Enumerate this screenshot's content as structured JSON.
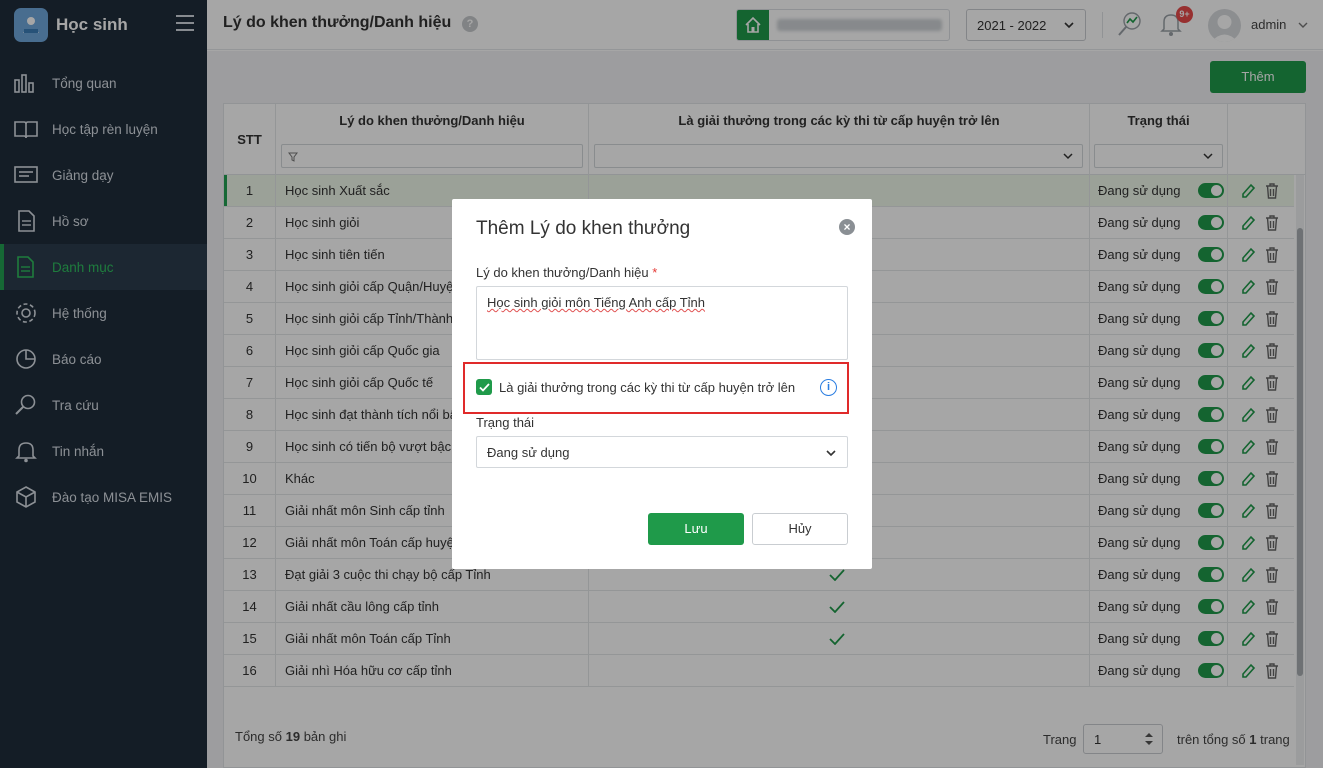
{
  "app": {
    "name": "Học sinh"
  },
  "sidebar": {
    "items": [
      {
        "label": "Tổng quan",
        "icon": "bar-chart-icon"
      },
      {
        "label": "Học tập rèn luyện",
        "icon": "book-icon"
      },
      {
        "label": "Giảng dạy",
        "icon": "board-icon"
      },
      {
        "label": "Hồ sơ",
        "icon": "document-icon"
      },
      {
        "label": "Danh mục",
        "icon": "list-icon",
        "active": true
      },
      {
        "label": "Hệ thống",
        "icon": "gear-icon"
      },
      {
        "label": "Báo cáo",
        "icon": "pie-chart-icon"
      },
      {
        "label": "Tra cứu",
        "icon": "search-icon"
      },
      {
        "label": "Tin nhắn",
        "icon": "bell-icon"
      },
      {
        "label": "Đào tạo MISA EMIS",
        "icon": "cube-icon"
      }
    ]
  },
  "header": {
    "title": "Lý do khen thưởng/Danh hiệu",
    "help": "?",
    "year": "2021 - 2022",
    "notification_badge": "9+",
    "username": "admin"
  },
  "toolbar": {
    "add_label": "Thêm"
  },
  "grid": {
    "columns": {
      "stt": "STT",
      "reason": "Lý do khen thưởng/Danh hiệu",
      "district": "Là giải thưởng trong các kỳ thi từ cấp huyện trở lên",
      "status": "Trạng thái"
    },
    "rows": [
      {
        "stt": "1",
        "reason": "Học sinh Xuất sắc",
        "district": false,
        "status": "Đang sử dụng"
      },
      {
        "stt": "2",
        "reason": "Học sinh giỏi",
        "district": false,
        "status": "Đang sử dụng"
      },
      {
        "stt": "3",
        "reason": "Học sinh tiên tiến",
        "district": false,
        "status": "Đang sử dụng"
      },
      {
        "stt": "4",
        "reason": "Học sinh giỏi cấp Quận/Huyện",
        "district": false,
        "status": "Đang sử dụng"
      },
      {
        "stt": "5",
        "reason": "Học sinh giỏi cấp Tỉnh/Thành phố",
        "district": false,
        "status": "Đang sử dụng"
      },
      {
        "stt": "6",
        "reason": "Học sinh giỏi cấp Quốc gia",
        "district": false,
        "status": "Đang sử dụng"
      },
      {
        "stt": "7",
        "reason": "Học sinh giỏi cấp Quốc tế",
        "district": false,
        "status": "Đang sử dụng"
      },
      {
        "stt": "8",
        "reason": "Học sinh đạt thành tích nổi bật",
        "district": false,
        "status": "Đang sử dụng"
      },
      {
        "stt": "9",
        "reason": "Học sinh có tiến bộ vượt bậc",
        "district": false,
        "status": "Đang sử dụng"
      },
      {
        "stt": "10",
        "reason": "Khác",
        "district": false,
        "status": "Đang sử dụng"
      },
      {
        "stt": "11",
        "reason": "Giải nhất môn Sinh cấp tỉnh",
        "district": false,
        "status": "Đang sử dụng"
      },
      {
        "stt": "12",
        "reason": "Giải nhất môn Toán cấp huyện",
        "district": false,
        "status": "Đang sử dụng"
      },
      {
        "stt": "13",
        "reason": "Đạt giải 3 cuộc thi chạy bộ cấp Tỉnh",
        "district": true,
        "status": "Đang sử dụng"
      },
      {
        "stt": "14",
        "reason": "Giải nhất cầu lông cấp tỉnh",
        "district": true,
        "status": "Đang sử dụng"
      },
      {
        "stt": "15",
        "reason": "Giải nhất môn Toán cấp Tỉnh",
        "district": true,
        "status": "Đang sử dụng"
      },
      {
        "stt": "16",
        "reason": "Giải nhì Hóa hữu cơ cấp tỉnh",
        "district": false,
        "status": "Đang sử dụng"
      }
    ]
  },
  "footer": {
    "total_prefix": "Tổng số",
    "total_count": "19",
    "total_suffix": "bản ghi",
    "page_label": "Trang",
    "page_value": "1",
    "page_total_prefix": "trên tổng số",
    "page_total_count": "1",
    "page_total_suffix": "trang"
  },
  "modal": {
    "title": "Thêm Lý do khen thưởng",
    "reason_label": "Lý do khen thưởng/Danh hiệu",
    "required_mark": "*",
    "reason_value": "Học sinh giỏi môn Tiếng Anh cấp Tỉnh",
    "checkbox_label": "Là giải thưởng trong các kỳ thi từ cấp huyện trở lên",
    "checkbox_checked": true,
    "info": "i",
    "status_label": "Trạng thái",
    "status_value": "Đang sử dụng",
    "save_label": "Lưu",
    "cancel_label": "Hủy"
  },
  "colors": {
    "brand": "#1f9a4a",
    "sidebar": "#1f2d3b",
    "danger": "#e02a2a",
    "info": "#2a7de1"
  }
}
